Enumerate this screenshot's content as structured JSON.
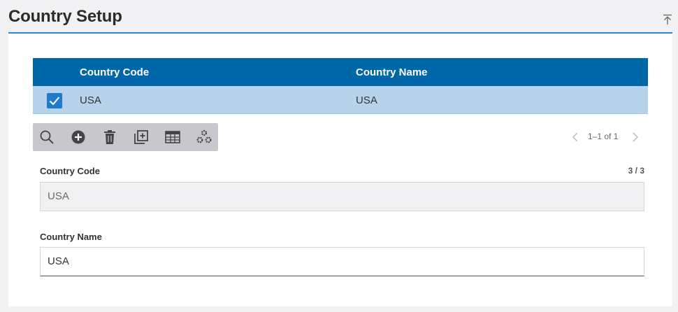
{
  "header": {
    "title": "Country Setup",
    "collapse_icon": "collapse-to-top-icon"
  },
  "grid": {
    "columns": [
      "Country Code",
      "Country Name"
    ],
    "rows": [
      {
        "code": "USA",
        "name": "USA",
        "selected": true
      }
    ]
  },
  "toolbar": {
    "buttons": [
      "search-icon",
      "add-icon",
      "delete-icon",
      "duplicate-icon",
      "table-view-icon",
      "settings-icon"
    ]
  },
  "pager": {
    "info": "1–1 of 1"
  },
  "form": {
    "country_code": {
      "label": "Country Code",
      "value": "USA",
      "counter": "3 / 3"
    },
    "country_name": {
      "label": "Country Name",
      "value": "USA"
    }
  },
  "colors": {
    "accent": "#0067a8",
    "selected_row": "#b7d3eb",
    "divider": "#2f86d0"
  }
}
